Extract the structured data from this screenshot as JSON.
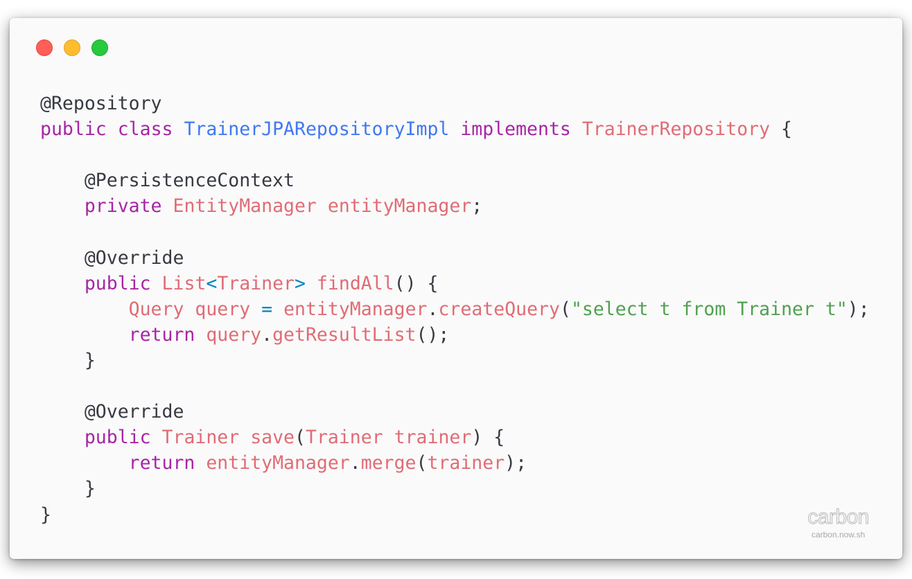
{
  "colors": {
    "window_background": "#fafafa",
    "keyword": "#a626a4",
    "class_name": "#4078f2",
    "type": "#e06c75",
    "operator": "#0184bc",
    "string": "#50a14f",
    "plain": "#383a42",
    "control_close": "#ff5f56",
    "control_minimize": "#ffbd2e",
    "control_maximize": "#27c93f"
  },
  "window_controls": {
    "close": "close-dot-icon",
    "minimize": "minimize-dot-icon",
    "maximize": "maximize-dot-icon"
  },
  "code": {
    "language": "java",
    "lines": [
      [
        {
          "k": "annotation",
          "t": "@Repository"
        }
      ],
      [
        {
          "k": "keyword",
          "t": "public"
        },
        {
          "k": "punc",
          "t": " "
        },
        {
          "k": "keyword",
          "t": "class"
        },
        {
          "k": "punc",
          "t": " "
        },
        {
          "k": "classname",
          "t": "TrainerJPARepositoryImpl"
        },
        {
          "k": "punc",
          "t": " "
        },
        {
          "k": "keyword",
          "t": "implements"
        },
        {
          "k": "punc",
          "t": " "
        },
        {
          "k": "type",
          "t": "TrainerRepository"
        },
        {
          "k": "punc",
          "t": " {"
        }
      ],
      [],
      [
        {
          "k": "punc",
          "t": "    "
        },
        {
          "k": "annotation",
          "t": "@PersistenceContext"
        }
      ],
      [
        {
          "k": "punc",
          "t": "    "
        },
        {
          "k": "keyword",
          "t": "private"
        },
        {
          "k": "punc",
          "t": " "
        },
        {
          "k": "type",
          "t": "EntityManager"
        },
        {
          "k": "punc",
          "t": " "
        },
        {
          "k": "ident",
          "t": "entityManager"
        },
        {
          "k": "punc",
          "t": ";"
        }
      ],
      [],
      [
        {
          "k": "punc",
          "t": "    "
        },
        {
          "k": "annotation",
          "t": "@Override"
        }
      ],
      [
        {
          "k": "punc",
          "t": "    "
        },
        {
          "k": "keyword",
          "t": "public"
        },
        {
          "k": "punc",
          "t": " "
        },
        {
          "k": "type",
          "t": "List"
        },
        {
          "k": "op",
          "t": "<"
        },
        {
          "k": "type",
          "t": "Trainer"
        },
        {
          "k": "op",
          "t": ">"
        },
        {
          "k": "punc",
          "t": " "
        },
        {
          "k": "func",
          "t": "findAll"
        },
        {
          "k": "punc",
          "t": "() {"
        }
      ],
      [
        {
          "k": "punc",
          "t": "        "
        },
        {
          "k": "type",
          "t": "Query"
        },
        {
          "k": "punc",
          "t": " "
        },
        {
          "k": "ident",
          "t": "query"
        },
        {
          "k": "punc",
          "t": " "
        },
        {
          "k": "op",
          "t": "="
        },
        {
          "k": "punc",
          "t": " "
        },
        {
          "k": "ident",
          "t": "entityManager"
        },
        {
          "k": "punc",
          "t": "."
        },
        {
          "k": "func",
          "t": "createQuery"
        },
        {
          "k": "punc",
          "t": "("
        },
        {
          "k": "string",
          "t": "\"select t from Trainer t\""
        },
        {
          "k": "punc",
          "t": ");"
        }
      ],
      [
        {
          "k": "punc",
          "t": "        "
        },
        {
          "k": "keyword",
          "t": "return"
        },
        {
          "k": "punc",
          "t": " "
        },
        {
          "k": "ident",
          "t": "query"
        },
        {
          "k": "punc",
          "t": "."
        },
        {
          "k": "func",
          "t": "getResultList"
        },
        {
          "k": "punc",
          "t": "();"
        }
      ],
      [
        {
          "k": "punc",
          "t": "    }"
        }
      ],
      [],
      [
        {
          "k": "punc",
          "t": "    "
        },
        {
          "k": "annotation",
          "t": "@Override"
        }
      ],
      [
        {
          "k": "punc",
          "t": "    "
        },
        {
          "k": "keyword",
          "t": "public"
        },
        {
          "k": "punc",
          "t": " "
        },
        {
          "k": "type",
          "t": "Trainer"
        },
        {
          "k": "punc",
          "t": " "
        },
        {
          "k": "func",
          "t": "save"
        },
        {
          "k": "punc",
          "t": "("
        },
        {
          "k": "type",
          "t": "Trainer"
        },
        {
          "k": "punc",
          "t": " "
        },
        {
          "k": "ident",
          "t": "trainer"
        },
        {
          "k": "punc",
          "t": ") {"
        }
      ],
      [
        {
          "k": "punc",
          "t": "        "
        },
        {
          "k": "keyword",
          "t": "return"
        },
        {
          "k": "punc",
          "t": " "
        },
        {
          "k": "ident",
          "t": "entityManager"
        },
        {
          "k": "punc",
          "t": "."
        },
        {
          "k": "func",
          "t": "merge"
        },
        {
          "k": "punc",
          "t": "("
        },
        {
          "k": "ident",
          "t": "trainer"
        },
        {
          "k": "punc",
          "t": ");"
        }
      ],
      [
        {
          "k": "punc",
          "t": "    }"
        }
      ],
      [
        {
          "k": "punc",
          "t": "}"
        }
      ]
    ]
  },
  "watermark": {
    "logo": "carbon",
    "url": "carbon.now.sh"
  }
}
